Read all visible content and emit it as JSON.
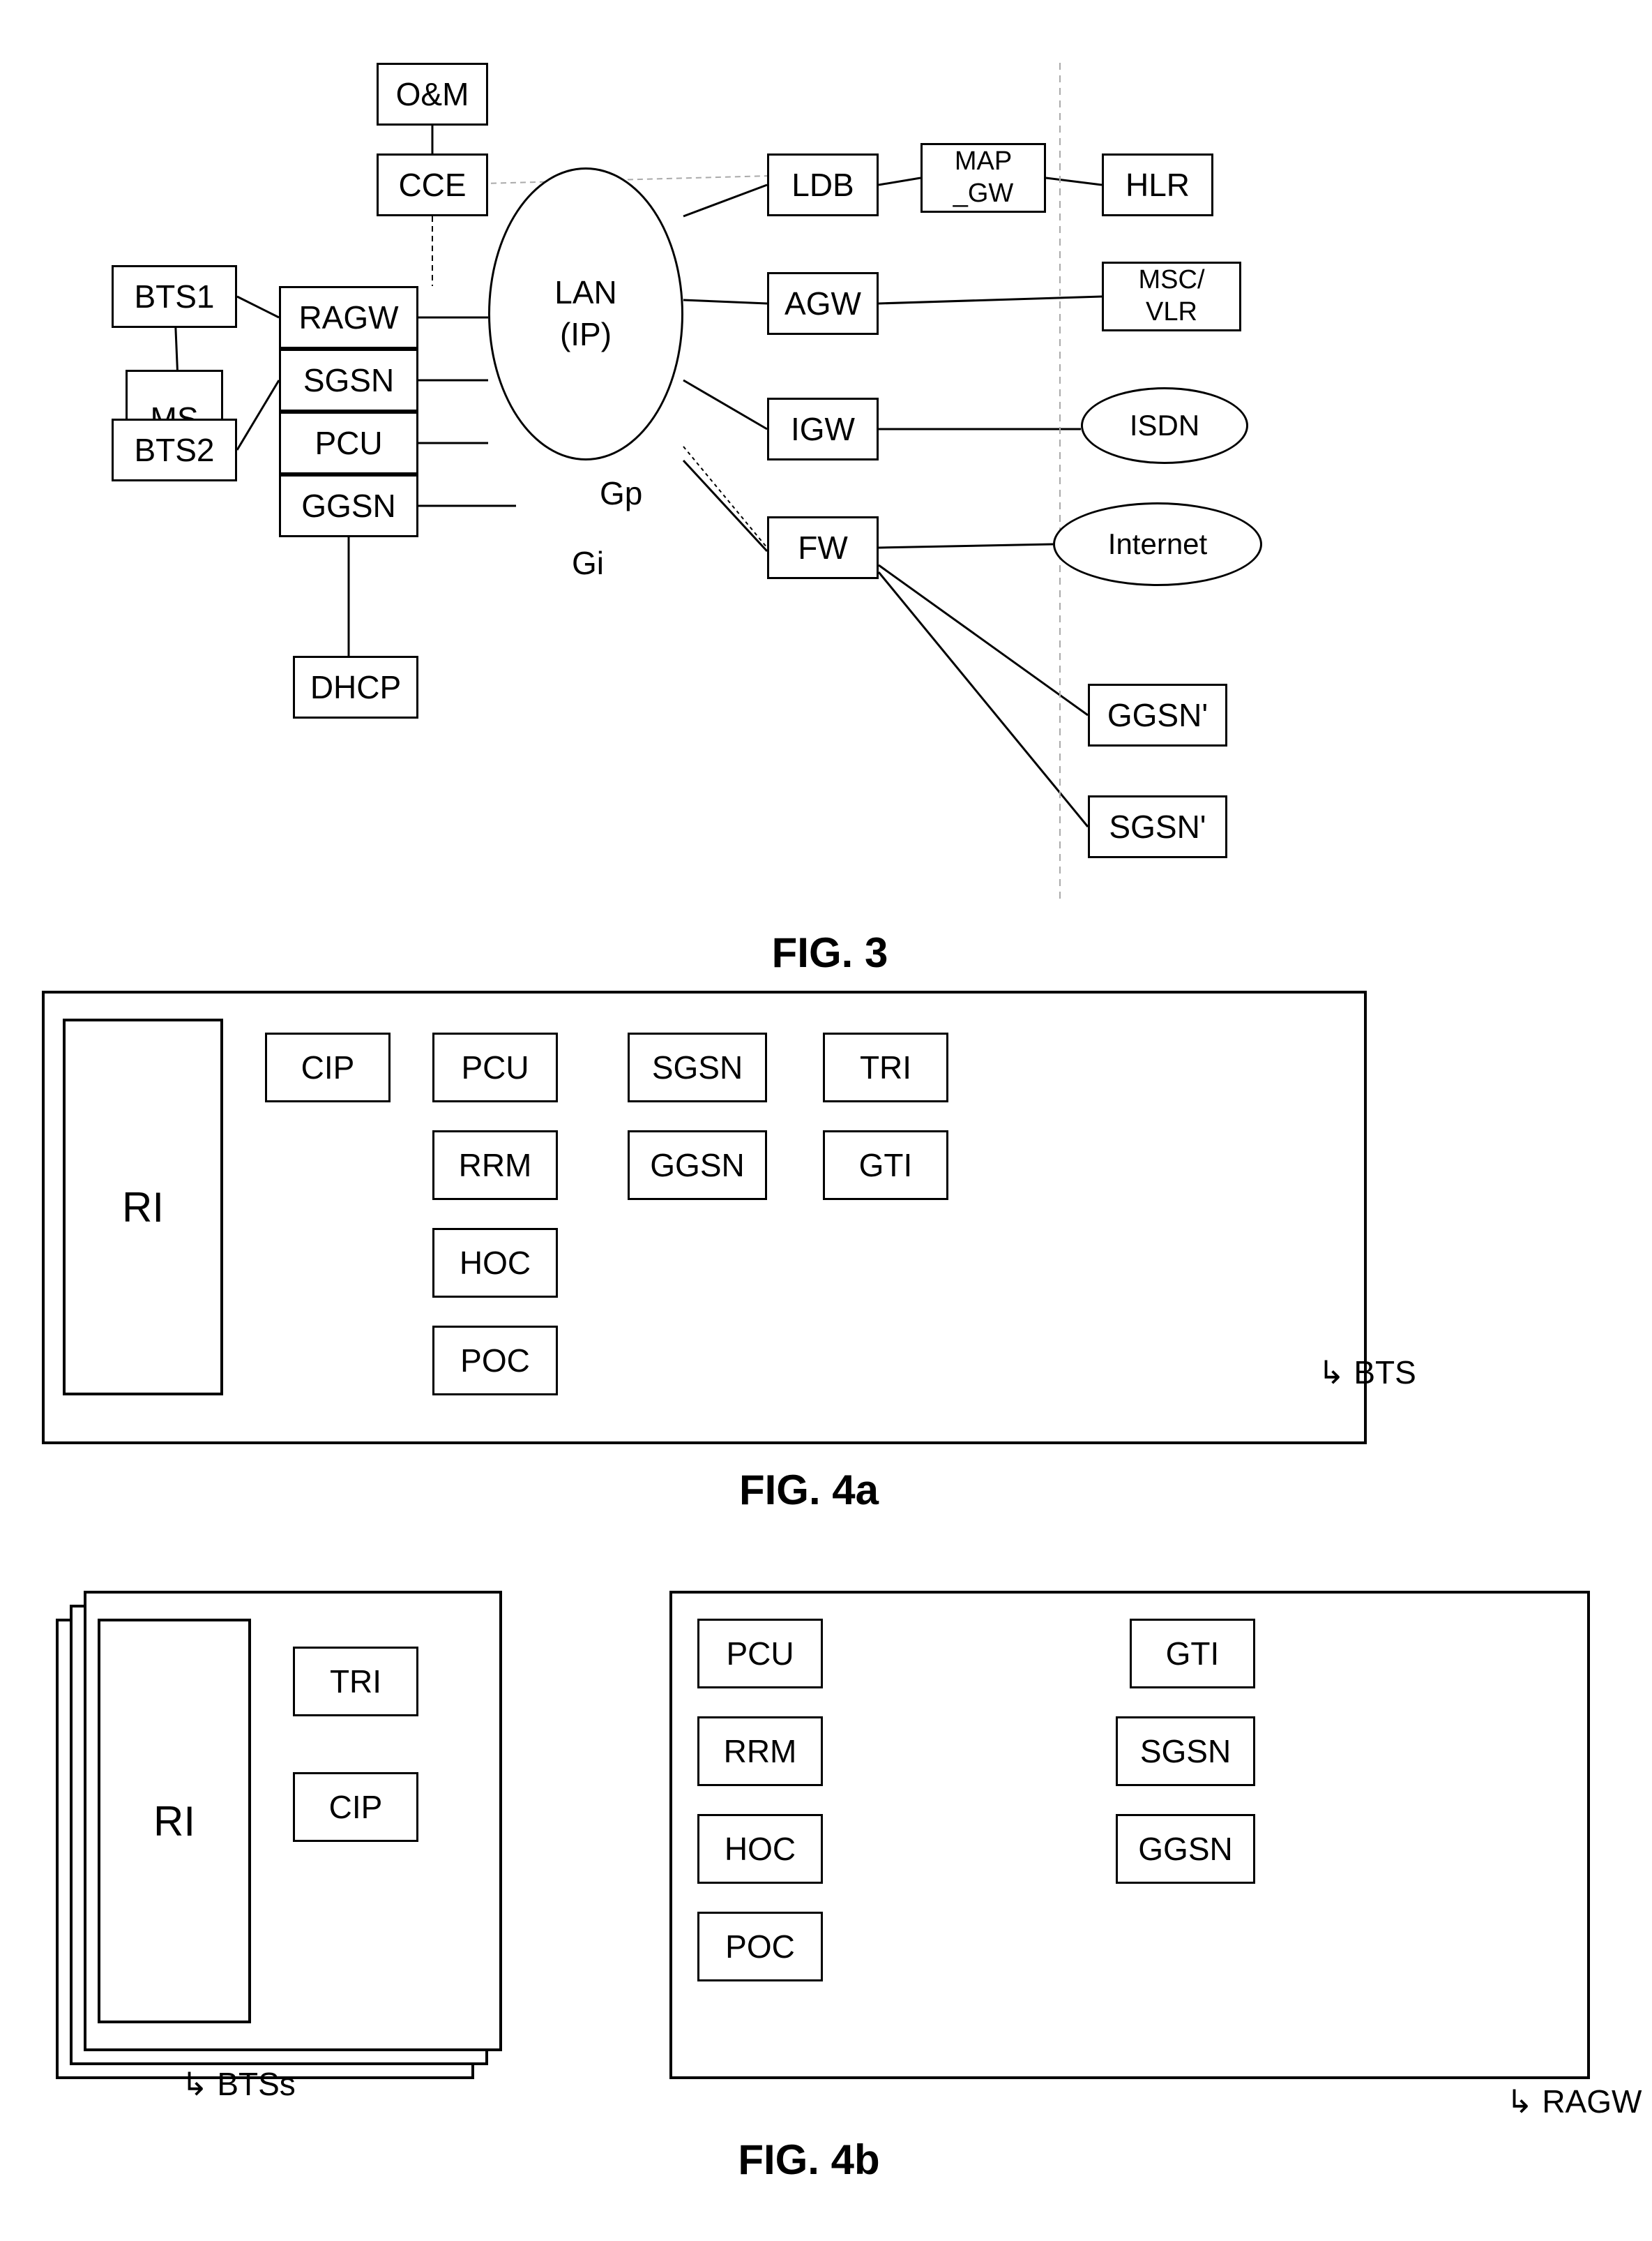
{
  "fig3": {
    "title": "FIG. 3",
    "nodes": {
      "om": "O&M",
      "cce": "CCE",
      "bts1": "BTS1",
      "bts2": "BTS2",
      "ragw": "RAGW",
      "sgsn": "SGSN",
      "pcu": "PCU",
      "ggsn": "GGSN",
      "dhcp": "DHCP",
      "lan": "LAN\n(IP)",
      "ldb": "LDB",
      "mapgw": "MAP\n_GW",
      "hlr": "HLR",
      "agw": "AGW",
      "mscvlr": "MSC/\nVLR",
      "igw": "IGW",
      "isdn": "ISDN",
      "fw": "FW",
      "internet": "Internet",
      "ggsn2": "GGSN'",
      "sgsn2": "SGSN'",
      "gp": "Gp",
      "gi": "Gi",
      "ms": "MS"
    }
  },
  "fig4a": {
    "title": "FIG. 4a",
    "nodes": {
      "ri": "RI",
      "cip": "CIP",
      "pcu": "PCU",
      "rrm": "RRM",
      "hoc": "HOC",
      "poc": "POC",
      "sgsn": "SGSN",
      "ggsn": "GGSN",
      "tri": "TRI",
      "gti": "GTI",
      "bts": "BTS"
    }
  },
  "fig4b": {
    "title": "FIG. 4b",
    "left": {
      "ri": "RI",
      "tri": "TRI",
      "cip": "CIP",
      "btss": "BTSs"
    },
    "right": {
      "pcu": "PCU",
      "gti": "GTI",
      "rrm": "RRM",
      "sgsn": "SGSN",
      "hoc": "HOC",
      "ggsn": "GGSN",
      "poc": "POC",
      "ragw": "RAGW"
    }
  }
}
